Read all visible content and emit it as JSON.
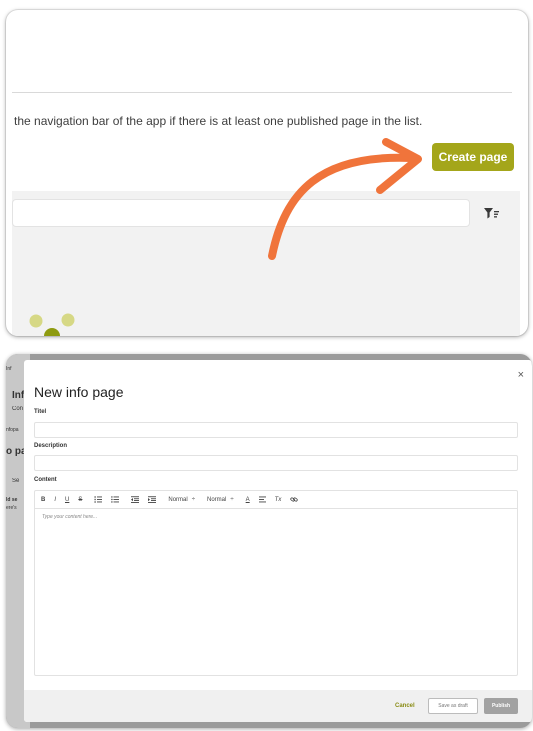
{
  "top": {
    "info_text": "the navigation bar of the app if there is at least one published page in the list.",
    "create_button": "Create page",
    "filter_icon": "filter-icon",
    "brand_color": "#a4a61a",
    "arrow_color": "#f0743b"
  },
  "background_fragments": [
    "Inf",
    "Con",
    "nfopa",
    "o pa",
    "Se",
    "ld se",
    "ere's"
  ],
  "modal": {
    "title": "New info page",
    "close": "×",
    "title_label": "Titel",
    "description_label": "Description",
    "content_label": "Content",
    "toolbar": {
      "bold": "B",
      "italic": "I",
      "underline": "U",
      "strike": "S",
      "font_select": "Normal",
      "size_select": "Normal",
      "select_arrow": "÷",
      "text_color": "A",
      "clear_format": "Tx"
    },
    "editor_placeholder": "Type your content here...",
    "cancel": "Cancel",
    "save_draft": "Save as draft",
    "publish": "Publish"
  }
}
